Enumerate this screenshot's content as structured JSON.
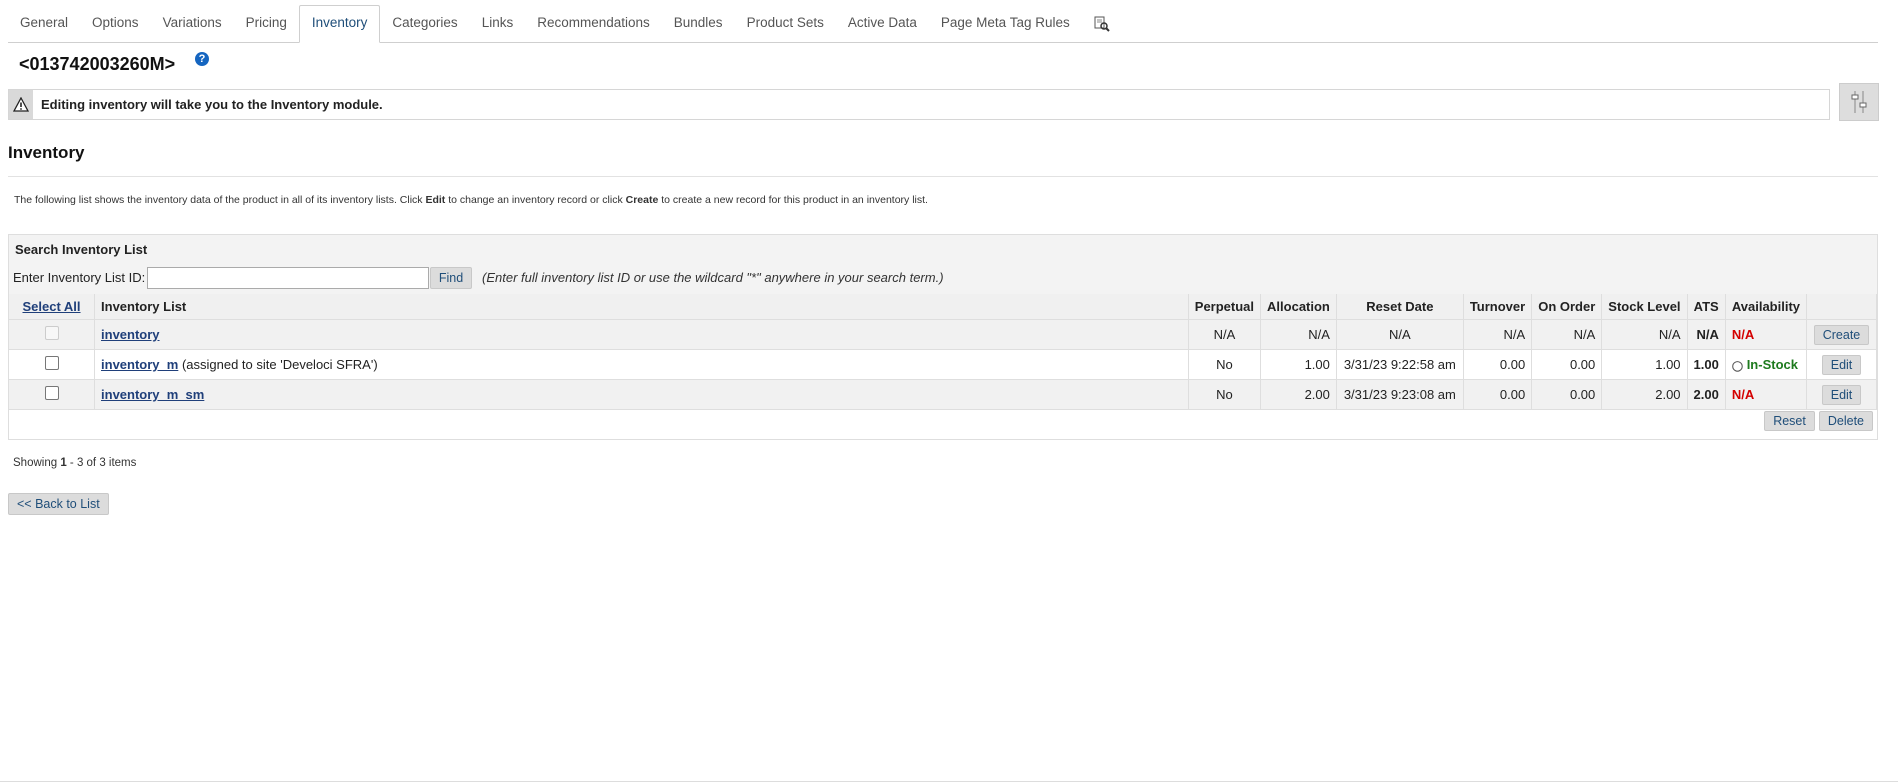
{
  "tabs": [
    "General",
    "Options",
    "Variations",
    "Pricing",
    "Inventory",
    "Categories",
    "Links",
    "Recommendations",
    "Bundles",
    "Product Sets",
    "Active Data",
    "Page Meta Tag Rules"
  ],
  "active_tab": "Inventory",
  "product_title": "<013742003260M>",
  "notice": "Editing inventory will take you to the Inventory module.",
  "section_title": "Inventory",
  "desc": {
    "p1": "The following list shows the inventory data of the product in all of its inventory lists. Click ",
    "edit": "Edit",
    "p2": " to change an inventory record or click ",
    "create": "Create",
    "p3": " to create a new record for this product in an inventory list."
  },
  "search": {
    "title": "Search Inventory List",
    "label": "Enter Inventory List ID:",
    "value": "",
    "find": "Find",
    "hint": "(Enter full inventory list ID or use the wildcard \"*\" anywhere in your search term.)"
  },
  "table": {
    "headers": {
      "select_all": "Select All",
      "list": "Inventory List",
      "perpetual": "Perpetual",
      "allocation": "Allocation",
      "reset_date": "Reset Date",
      "turnover": "Turnover",
      "on_order": "On Order",
      "stock_level": "Stock Level",
      "ats": "ATS",
      "availability": "Availability"
    },
    "rows": [
      {
        "name": "inventory",
        "note": "",
        "perpetual": "N/A",
        "allocation": "N/A",
        "reset_date": "N/A",
        "turnover": "N/A",
        "on_order": "N/A",
        "stock_level": "N/A",
        "ats": "N/A",
        "availability": "N/A",
        "action": "Create"
      },
      {
        "name": "inventory_m",
        "note": "(assigned to site 'Develoci SFRA')",
        "perpetual": "No",
        "allocation": "1.00",
        "reset_date": "3/31/23 9:22:58 am",
        "turnover": "0.00",
        "on_order": "0.00",
        "stock_level": "1.00",
        "ats": "1.00",
        "availability": "In-Stock",
        "action": "Edit"
      },
      {
        "name": "inventory_m_sm",
        "note": "",
        "perpetual": "No",
        "allocation": "2.00",
        "reset_date": "3/31/23 9:23:08 am",
        "turnover": "0.00",
        "on_order": "0.00",
        "stock_level": "2.00",
        "ats": "2.00",
        "availability": "N/A",
        "action": "Edit"
      }
    ]
  },
  "buttons": {
    "reset": "Reset",
    "delete": "Delete",
    "back": "<< Back to List"
  },
  "showing": {
    "prefix": "Showing ",
    "range": "1",
    "mid": " - 3 of 3 items"
  },
  "colors": {
    "link": "#1f3f7a",
    "na": "#d40000",
    "in_stock": "#1d7a1d",
    "button": "#dcdcdc"
  }
}
